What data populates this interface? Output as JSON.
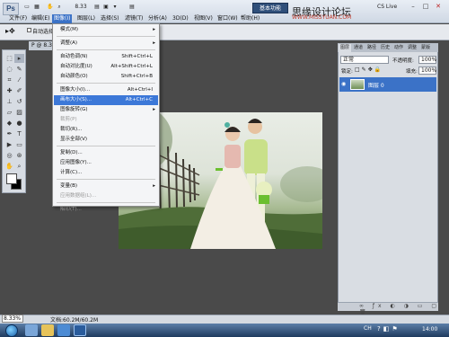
{
  "app": {
    "logo": "Ps",
    "workspace_button": "基本功能",
    "watermark_line1": "思缘设计论坛",
    "watermark_line2": "WWW.MISSYUAN.COM",
    "cs_live": "CS Live",
    "toolbar_zoom": "8.33"
  },
  "menubar": {
    "items": [
      "文件(F)",
      "编辑(E)",
      "图像(I)",
      "图层(L)",
      "选择(S)",
      "滤镜(T)",
      "分析(A)",
      "3D(D)",
      "视图(V)",
      "窗口(W)",
      "帮助(H)"
    ]
  },
  "options_bar": {
    "auto_select": "自动选择"
  },
  "document": {
    "tab_title": "P @ 8.33%",
    "zoom": "8.33%",
    "doc_info": "文档:60.2M/60.2M"
  },
  "image_menu": {
    "items": [
      {
        "label": "模式(M)",
        "shortcut": "",
        "submenu": true,
        "disabled": false,
        "highlight": false
      },
      {
        "sep": true
      },
      {
        "label": "调整(A)",
        "shortcut": "",
        "submenu": true,
        "disabled": false,
        "highlight": false
      },
      {
        "sep": true
      },
      {
        "label": "自动色调(N)",
        "shortcut": "Shift+Ctrl+L",
        "submenu": false,
        "disabled": false,
        "highlight": false
      },
      {
        "label": "自动对比度(U)",
        "shortcut": "Alt+Shift+Ctrl+L",
        "submenu": false,
        "disabled": false,
        "highlight": false
      },
      {
        "label": "自动颜色(O)",
        "shortcut": "Shift+Ctrl+B",
        "submenu": false,
        "disabled": false,
        "highlight": false
      },
      {
        "sep": true
      },
      {
        "label": "图像大小(I)...",
        "shortcut": "Alt+Ctrl+I",
        "submenu": false,
        "disabled": false,
        "highlight": false
      },
      {
        "label": "画布大小(S)...",
        "shortcut": "Alt+Ctrl+C",
        "submenu": false,
        "disabled": false,
        "highlight": true
      },
      {
        "label": "图像旋转(G)",
        "shortcut": "",
        "submenu": true,
        "disabled": false,
        "highlight": false
      },
      {
        "label": "裁剪(P)",
        "shortcut": "",
        "submenu": false,
        "disabled": true,
        "highlight": false
      },
      {
        "label": "裁切(R)...",
        "shortcut": "",
        "submenu": false,
        "disabled": false,
        "highlight": false
      },
      {
        "label": "显示全部(V)",
        "shortcut": "",
        "submenu": false,
        "disabled": false,
        "highlight": false
      },
      {
        "sep": true
      },
      {
        "label": "复制(D)...",
        "shortcut": "",
        "submenu": false,
        "disabled": false,
        "highlight": false
      },
      {
        "label": "应用图像(Y)...",
        "shortcut": "",
        "submenu": false,
        "disabled": false,
        "highlight": false
      },
      {
        "label": "计算(C)...",
        "shortcut": "",
        "submenu": false,
        "disabled": false,
        "highlight": false
      },
      {
        "sep": true
      },
      {
        "label": "变量(B)",
        "shortcut": "",
        "submenu": true,
        "disabled": false,
        "highlight": false
      },
      {
        "label": "应用数据组(L)...",
        "shortcut": "",
        "submenu": false,
        "disabled": true,
        "highlight": false
      },
      {
        "sep": true
      },
      {
        "label": "陷印(T)...",
        "shortcut": "",
        "submenu": false,
        "disabled": true,
        "highlight": false
      }
    ]
  },
  "layers_panel": {
    "tabs": [
      "图层",
      "通道",
      "路径",
      "历史",
      "动作",
      "调整",
      "蒙版"
    ],
    "blend_mode": "正常",
    "opacity_label": "不透明度:",
    "opacity_value": "100%",
    "lock_label": "锁定:",
    "fill_label": "填充:",
    "fill_value": "100%",
    "layer_name": "图层 0"
  },
  "taskbar": {
    "lang": "CH",
    "time": "14:00"
  }
}
